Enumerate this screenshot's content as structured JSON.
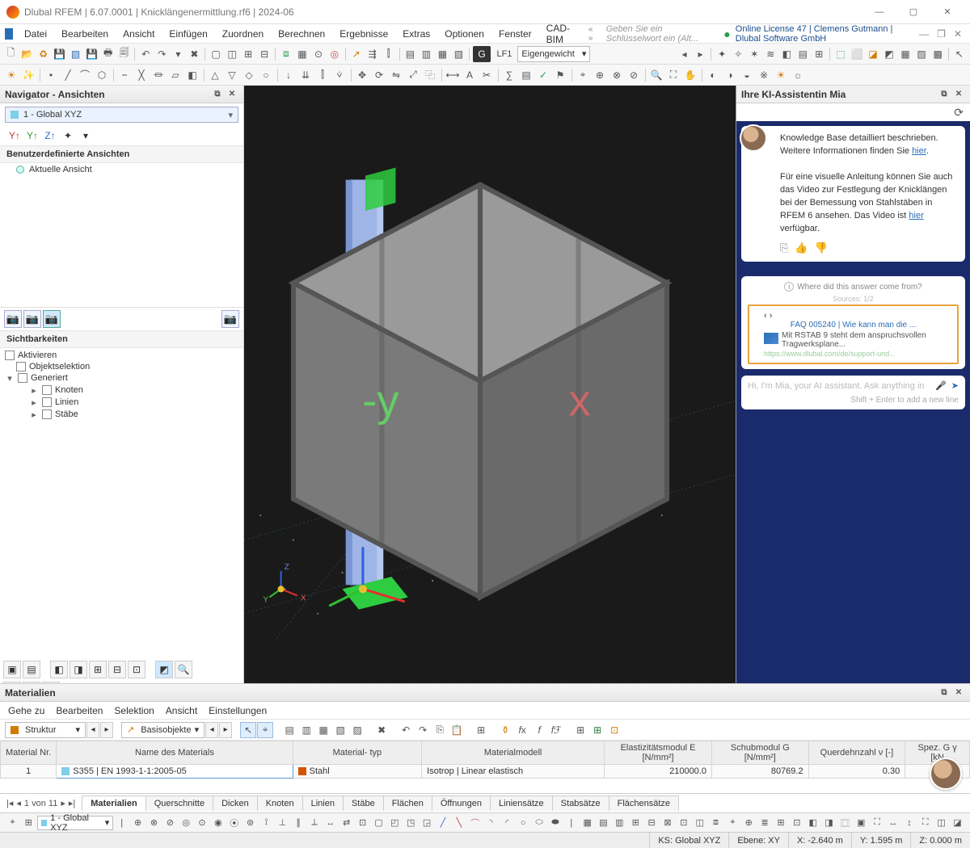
{
  "titlebar": {
    "app": "Dlubal RFEM",
    "version": "6.07.0001",
    "file": "Knicklängenermittlung.rf6",
    "date": "2024-06"
  },
  "menu": {
    "items": [
      "Datei",
      "Bearbeiten",
      "Ansicht",
      "Einfügen",
      "Zuordnen",
      "Berechnen",
      "Ergebnisse",
      "Extras",
      "Optionen",
      "Fenster",
      "CAD-BIM"
    ],
    "search_placeholder": "Geben Sie ein Schlüsselwort ein (Alt...",
    "license": "Online License 47 | Clemens Gutmann | Dlubal Software GmbH"
  },
  "toolbar1": {
    "loadcase_code": "LF1",
    "loadcase_name": "Eigengewicht"
  },
  "navigator": {
    "title": "Navigator - Ansichten",
    "view_combo": "1 - Global XYZ",
    "section_user": "Benutzerdefinierte Ansichten",
    "item_current": "Aktuelle Ansicht",
    "section_vis": "Sichtbarkeiten",
    "cb_activate": "Aktivieren",
    "cb_objsel": "Objektselektion",
    "cb_gen": "Generiert",
    "cb_nodes": "Knoten",
    "cb_lines": "Linien",
    "cb_members": "Stäbe"
  },
  "chat": {
    "title": "Ihre KI-Assistentin Mia",
    "msg_part1": "Knowledge Base detailliert beschrieben. Weitere Informationen finden Sie ",
    "msg_link1": "hier",
    "msg_part2": "Für eine visuelle Anleitung können Sie auch das Video zur Festlegung der Knicklängen bei der Bemessung von Stahlstäben in RFEM 6 ansehen. Das Video ist ",
    "msg_link2": "hier",
    "msg_part3": " verfügbar.",
    "src_q": "Where did this answer come from?",
    "src_label": "Sources: 1/2",
    "card_title": "FAQ 005240 | Wie kann man die ...",
    "card_desc": "Mit RSTAB 9 steht dem anspruchsvollen Tragwerksplane...",
    "card_url": "https://www.dlubal.com/de/support-und...",
    "input_placeholder": "Hi, I'm Mia, your AI assistant. Ask anything in",
    "hint": "Shift + Enter to add a new line"
  },
  "materials": {
    "title": "Materialien",
    "menu": [
      "Gehe zu",
      "Bearbeiten",
      "Selektion",
      "Ansicht",
      "Einstellungen"
    ],
    "combo1": "Struktur",
    "combo2": "Basisobjekte",
    "headers": {
      "nr": "Material\nNr.",
      "name": "Name des Materials",
      "type": "Material-\ntyp",
      "model": "Materialmodell",
      "e": "Elastizitätsmodul\nE [N/mm²]",
      "g": "Schubmodul\nG [N/mm²]",
      "v": "Querdehnzahl\nν [-]",
      "sg": "Spez. G\nγ [kN"
    },
    "row": {
      "nr": "1",
      "name": "S355 | EN 1993-1-1:2005-05",
      "type": "Stahl",
      "model": "Isotrop | Linear elastisch",
      "e": "210000.0",
      "g": "80769.2",
      "v": "0.30"
    },
    "page_info": "1 von 11",
    "tabs": [
      "Materialien",
      "Querschnitte",
      "Dicken",
      "Knoten",
      "Linien",
      "Stäbe",
      "Flächen",
      "Öffnungen",
      "Liniensätze",
      "Stabsätze",
      "Flächensätze"
    ]
  },
  "status": {
    "combo": "1 - Global XYZ",
    "cs": "KS: Global XYZ",
    "plane": "Ebene: XY",
    "x": "X: -2.640 m",
    "y": "Y: 1.595 m",
    "z": "Z: 0.000 m"
  }
}
